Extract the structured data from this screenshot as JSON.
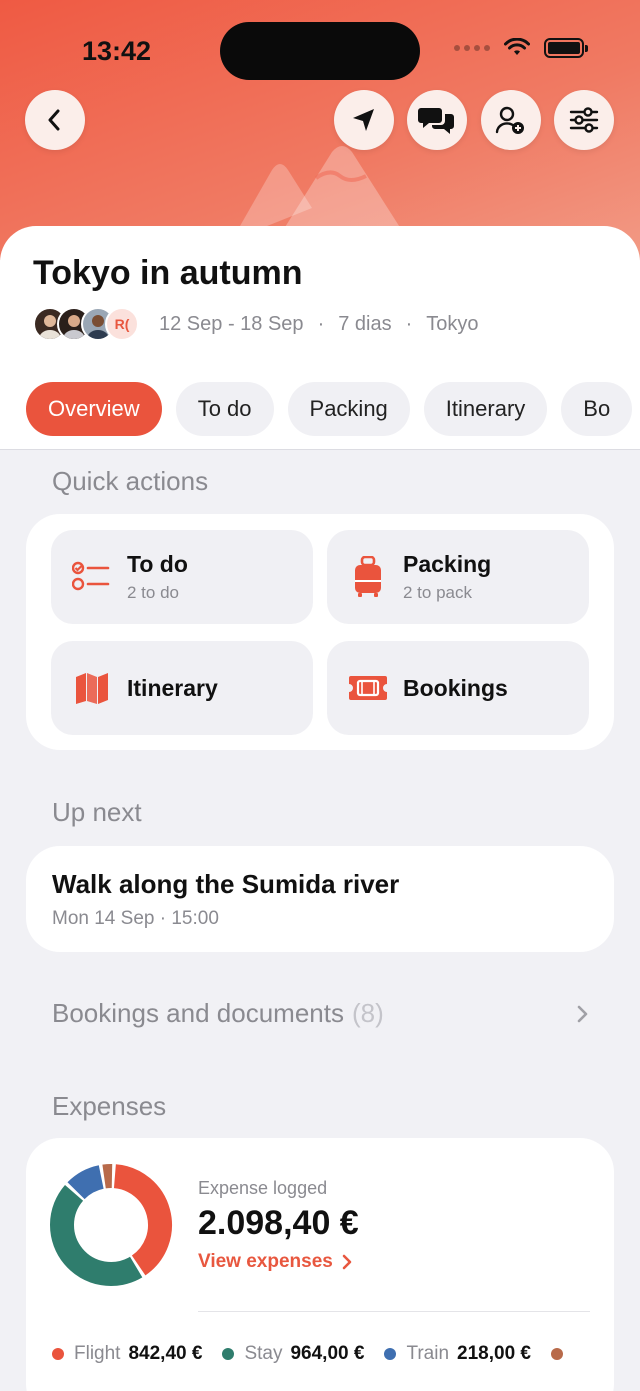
{
  "status_bar": {
    "time": "13:42"
  },
  "trip": {
    "title": "Tokyo in autumn",
    "avatar_initials": "R(",
    "dates": "12 Sep - 18 Sep",
    "duration": "7 dias",
    "location": "Tokyo",
    "separator": "·"
  },
  "tabs": [
    {
      "label": "Overview",
      "active": true
    },
    {
      "label": "To do",
      "active": false
    },
    {
      "label": "Packing",
      "active": false
    },
    {
      "label": "Itinerary",
      "active": false
    },
    {
      "label": "Bo",
      "active": false
    }
  ],
  "quick_actions": {
    "heading": "Quick actions",
    "items": [
      {
        "title": "To do",
        "subtitle": "2 to do",
        "icon": "checklist-icon"
      },
      {
        "title": "Packing",
        "subtitle": "2 to pack",
        "icon": "suitcase-icon"
      },
      {
        "title": "Itinerary",
        "subtitle": "",
        "icon": "map-icon"
      },
      {
        "title": "Bookings",
        "subtitle": "",
        "icon": "ticket-icon"
      }
    ]
  },
  "up_next": {
    "heading": "Up next",
    "title": "Walk along the Sumida river",
    "subtitle": "Mon 14 Sep · 15:00"
  },
  "bookings_documents": {
    "label": "Bookings and documents",
    "count": "(8)"
  },
  "expenses": {
    "heading": "Expenses",
    "label": "Expense logged",
    "total": "2.098,40 €",
    "link": "View expenses",
    "categories": [
      {
        "name": "Flight",
        "amount": "842,40 €",
        "value": 842.4,
        "color": "#ea543d"
      },
      {
        "name": "Stay",
        "amount": "964,00 €",
        "value": 964.0,
        "color": "#2f7d6d"
      },
      {
        "name": "Train",
        "amount": "218,00 €",
        "value": 218.0,
        "color": "#3f6fb0"
      },
      {
        "name": "",
        "amount": "",
        "value": 74.0,
        "color": "#b86a4a"
      }
    ]
  },
  "colors": {
    "accent": "#ea543d",
    "hero": "#ef5a43"
  }
}
